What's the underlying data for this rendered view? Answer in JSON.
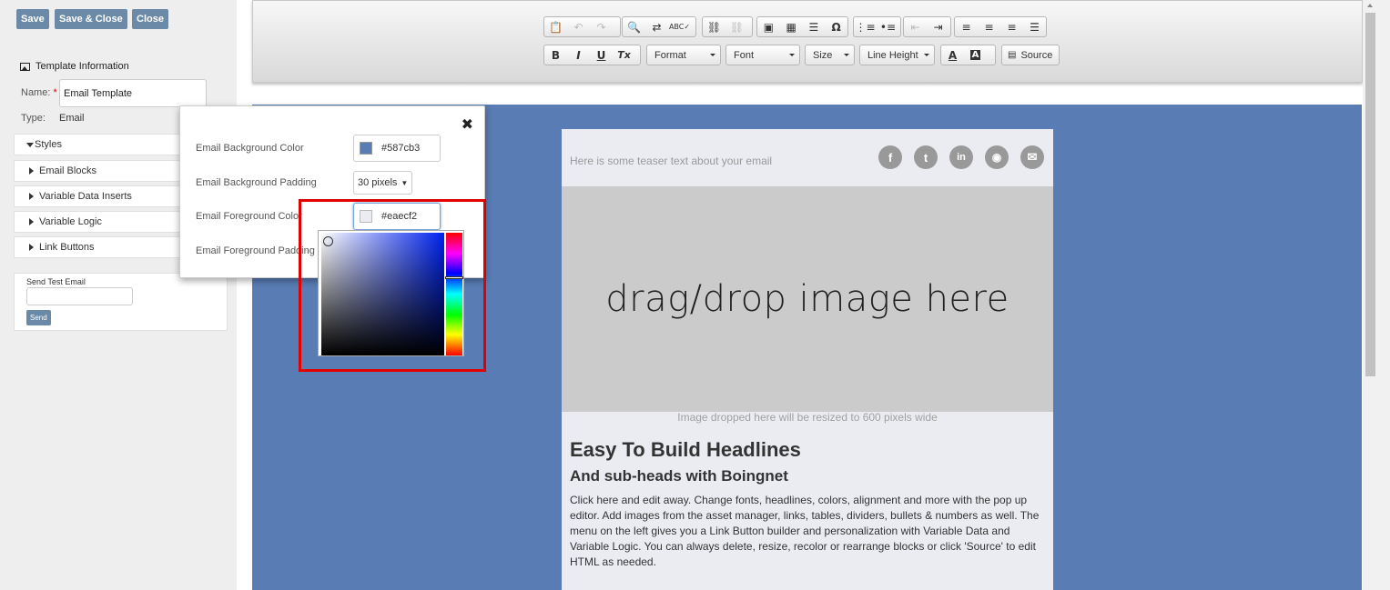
{
  "left_panel": {
    "buttons": {
      "save": "Save",
      "save_close": "Save & Close",
      "close": "Close"
    },
    "section_title": "Template Information",
    "name_label": "Name:",
    "name_required": "*",
    "name_value": "Email Template",
    "type_label": "Type:",
    "type_value": "Email",
    "accordion": [
      "Styles",
      "Email Blocks",
      "Variable Data Inserts",
      "Variable Logic",
      "Link Buttons"
    ],
    "send_test": {
      "label": "Send Test Email",
      "button": "Send"
    }
  },
  "toolbar": {
    "row1_icons": [
      "paste-icon",
      "undo-icon",
      "redo-icon",
      "find-icon",
      "replace-icon",
      "spellcheck-icon",
      "link-icon",
      "unlink-icon",
      "image-icon",
      "table-icon",
      "horizontal-rule-icon",
      "special-char-icon",
      "numbered-list-icon",
      "bulleted-list-icon",
      "outdent-icon",
      "indent-icon",
      "align-left-icon",
      "align-center-icon",
      "align-right-icon",
      "justify-icon"
    ],
    "row2": {
      "bold": "B",
      "italic": "I",
      "underline": "U",
      "remove_format": "Tx",
      "format": "Format",
      "font": "Font",
      "size": "Size",
      "line_height": "Line Height",
      "text_color": "A",
      "bg_color": "A",
      "source": "Source"
    }
  },
  "popup": {
    "close": "✖",
    "bg_color_label": "Email Background Color",
    "bg_color_value": "#587cb3",
    "bg_padding_label": "Email Background Padding",
    "bg_padding_value": "30 pixels",
    "fg_color_label": "Email Foreground Color",
    "fg_color_value": "#eaecf2",
    "fg_padding_label": "Email Foreground Padding"
  },
  "email": {
    "teaser": "Here is some teaser text about your email",
    "social_icons": [
      "facebook-icon",
      "tumblr-icon",
      "linkedin-icon",
      "rss-icon",
      "email-icon"
    ],
    "dropzone_text": "drag/drop image here",
    "resize_note": "Image dropped here will be resized to 600 pixels wide",
    "headline": "Easy To Build Headlines",
    "subhead": "And sub-heads with Boingnet",
    "body": "Click here and edit away. Change fonts, headlines, colors, alignment and more with the pop up editor. Add images from the asset manager, links, tables, dividers, bullets & numbers as well. The menu on the left gives you a Link Button builder and personalization with Variable Data and Variable Logic. You can always delete, resize, recolor or rearrange blocks or click 'Source' to edit HTML as needed."
  },
  "colors": {
    "canvas_bg": "#587cb3",
    "email_fg": "#eaecf2",
    "button": "#6b8aa8",
    "highlight": "#e00000"
  }
}
